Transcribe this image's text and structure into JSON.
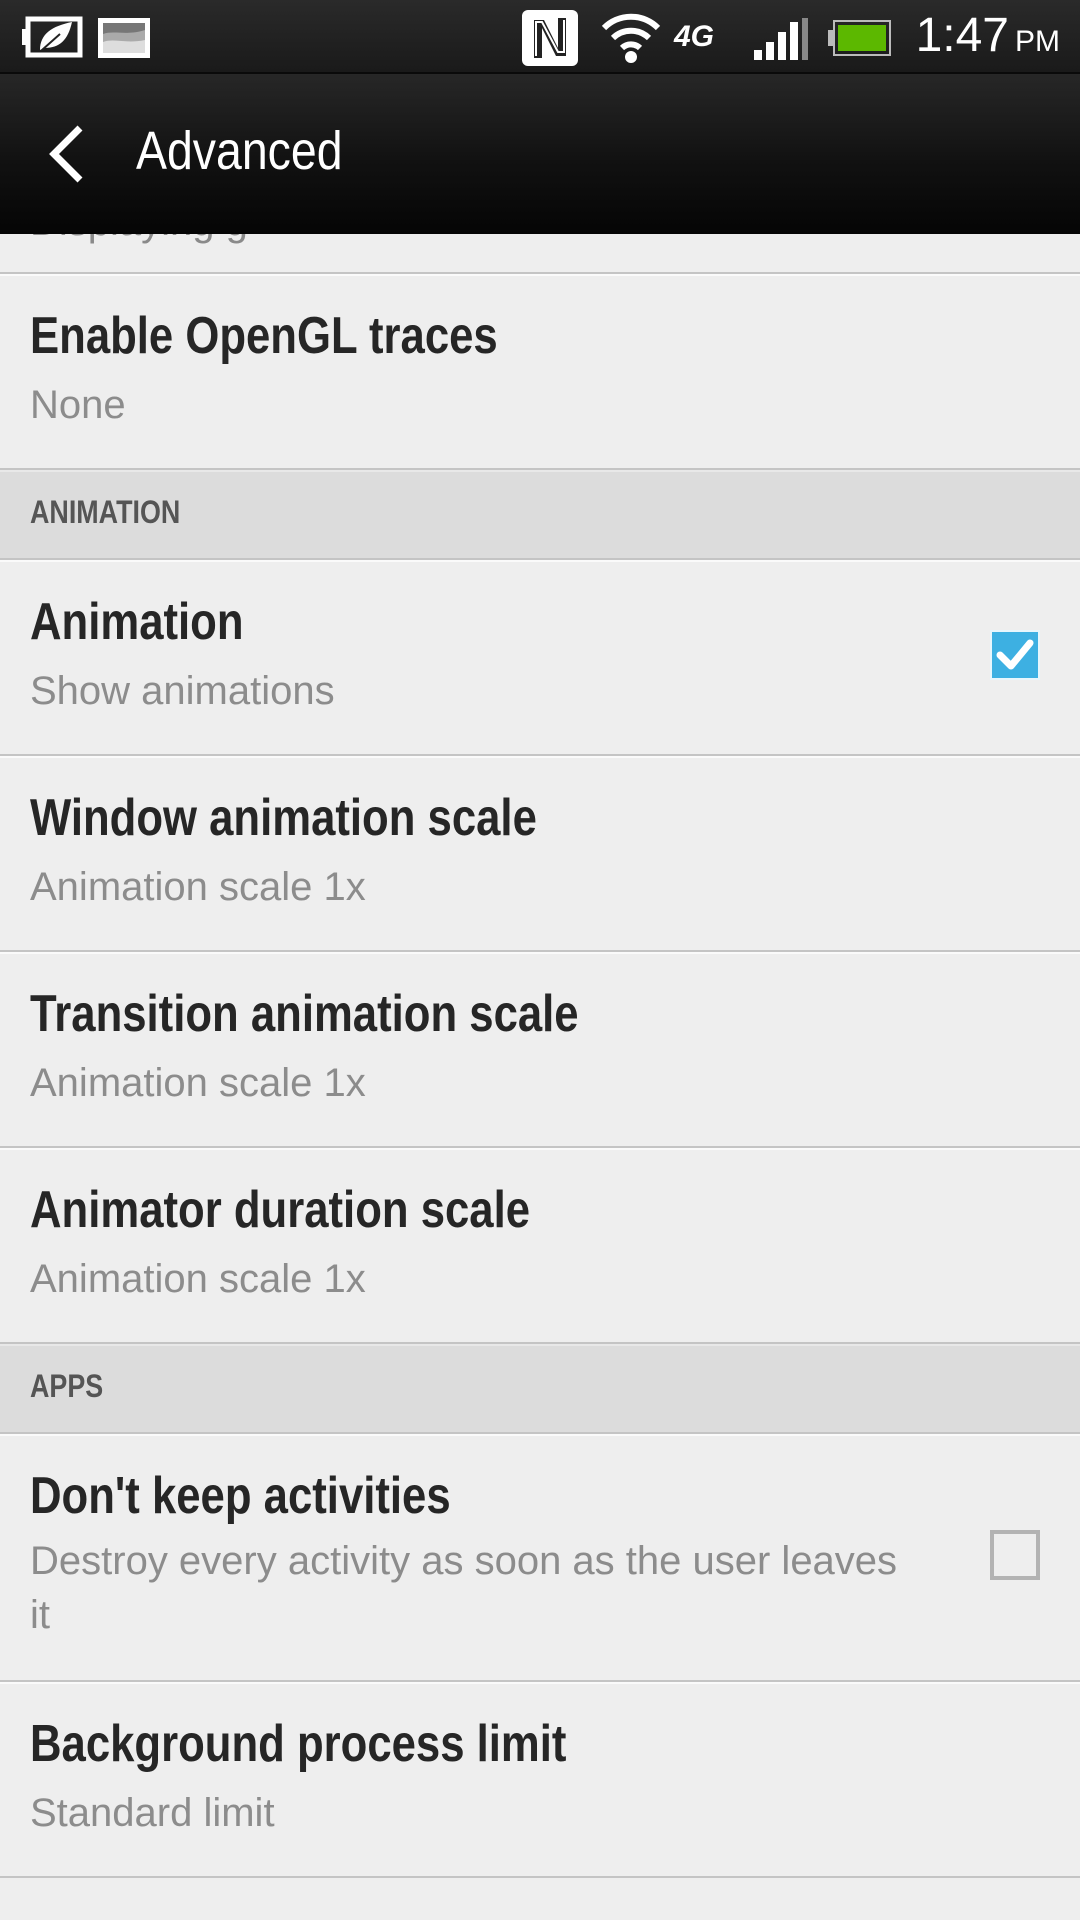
{
  "status_bar": {
    "icons": [
      "power-saver-icon",
      "gallery-icon",
      "nfc-icon",
      "wifi-icon",
      "4g-icon",
      "signal-icon",
      "battery-icon"
    ],
    "network_label": "4G",
    "time": "1:47",
    "ampm": "PM",
    "battery_color": "#5cb800"
  },
  "app_bar": {
    "title": "Advanced",
    "back_icon": "chevron-left-icon"
  },
  "list": {
    "partial_item_text": "Displaying g",
    "items_before": [
      {
        "title": "Enable OpenGL traces",
        "summary": "None"
      }
    ],
    "sections": [
      {
        "header": "ANIMATION",
        "items": [
          {
            "title": "Animation",
            "summary": "Show animations",
            "checkbox": true,
            "checked": true
          },
          {
            "title": "Window animation scale",
            "summary": "Animation scale 1x"
          },
          {
            "title": "Transition animation scale",
            "summary": "Animation scale 1x"
          },
          {
            "title": "Animator duration scale",
            "summary": "Animation scale 1x"
          }
        ]
      },
      {
        "header": "APPS",
        "items": [
          {
            "title": "Don't keep activities",
            "summary": "Destroy every activity as soon as the user leaves it",
            "checkbox": true,
            "checked": false
          },
          {
            "title": "Background process limit",
            "summary": "Standard limit"
          }
        ]
      }
    ]
  },
  "colors": {
    "checkbox_accent": "#3db0e2",
    "title_text": "#262626",
    "summary_text": "#8c8c8c",
    "section_bg": "#dcdcdc"
  }
}
